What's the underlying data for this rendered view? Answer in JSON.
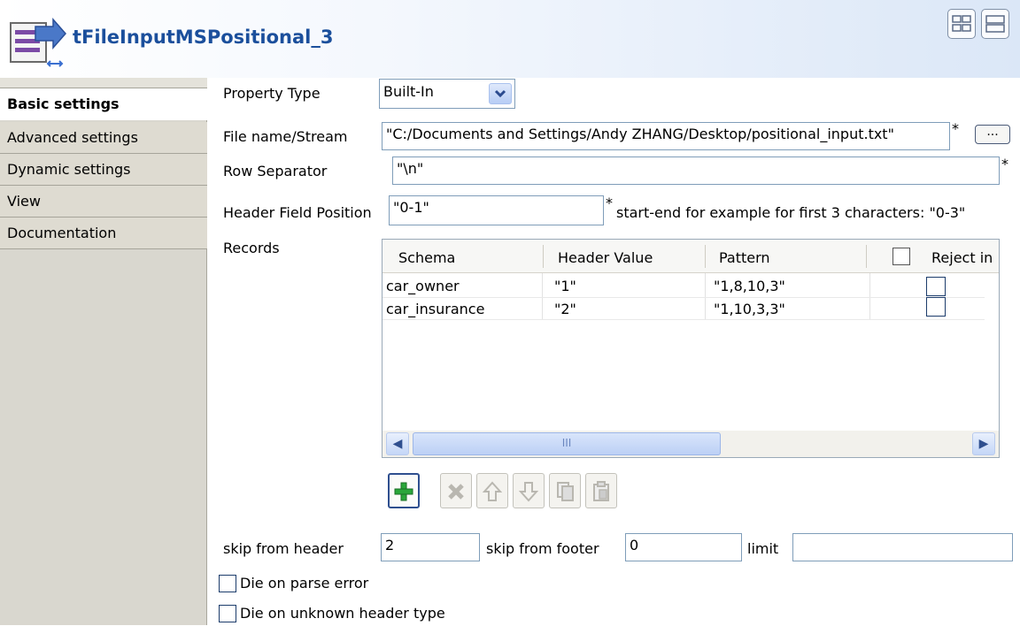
{
  "header": {
    "title": "tFileInputMSPositional_3"
  },
  "sidebar": {
    "items": [
      {
        "label": "Basic settings"
      },
      {
        "label": "Advanced settings"
      },
      {
        "label": "Dynamic settings"
      },
      {
        "label": "View"
      },
      {
        "label": "Documentation"
      }
    ]
  },
  "form": {
    "property_type": {
      "label": "Property Type",
      "value": "Built-In"
    },
    "file_name": {
      "label": "File name/Stream",
      "value": "\"C:/Documents and Settings/Andy ZHANG/Desktop/positional_input.txt\"",
      "browse_label": "..."
    },
    "row_separator": {
      "label": "Row Separator",
      "value": "\"\\n\""
    },
    "header_field_position": {
      "label": "Header Field Position",
      "value": "\"0-1\"",
      "hint": "start-end for example for first 3 characters: \"0-3\""
    },
    "required_mark": "*"
  },
  "records": {
    "label": "Records",
    "columns": [
      "Schema",
      "Header Value",
      "Pattern",
      "Reject in"
    ],
    "rows": [
      {
        "schema": "car_owner",
        "header_value": "\"1\"",
        "pattern": "\"1,8,10,3\""
      },
      {
        "schema": "car_insurance",
        "header_value": "\"2\"",
        "pattern": "\"1,10,3,3\""
      }
    ],
    "scroll_thumb": "III"
  },
  "toolbar": {
    "buttons": [
      {
        "name": "add-row-button",
        "icon": "plus-icon"
      },
      {
        "name": "remove-row-button",
        "icon": "delete-icon"
      },
      {
        "name": "move-up-button",
        "icon": "arrow-up-icon"
      },
      {
        "name": "move-down-button",
        "icon": "arrow-down-icon"
      },
      {
        "name": "copy-button",
        "icon": "copy-icon"
      },
      {
        "name": "paste-button",
        "icon": "paste-icon"
      }
    ]
  },
  "skip": {
    "header_label": "skip from header",
    "header_value": "2",
    "footer_label": "skip from footer",
    "footer_value": "0",
    "limit_label": "limit",
    "limit_value": ""
  },
  "options": {
    "die_on_parse_error": "Die on parse error",
    "die_on_unknown_header": "Die on unknown header type"
  },
  "colors": {
    "title": "#1b4f9c",
    "add_icon": "#21a33a",
    "accent_border": "#2f4f8f"
  }
}
